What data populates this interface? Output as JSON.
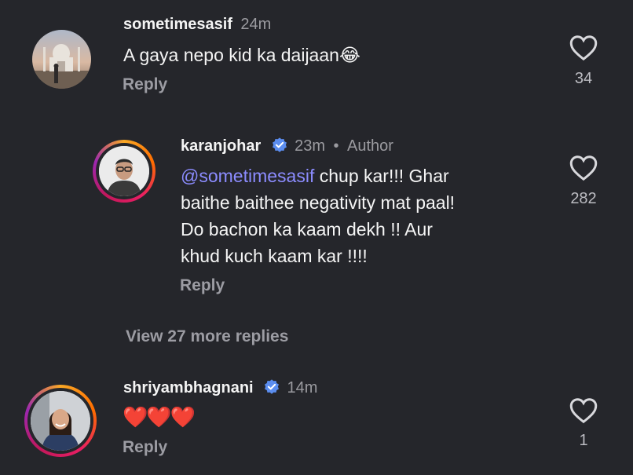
{
  "comments": [
    {
      "username": "sometimesasif",
      "time": "24m",
      "text": "A gaya nepo kid ka daijaan",
      "emoji": "😂",
      "reply_label": "Reply",
      "likes": "34"
    }
  ],
  "reply": {
    "username": "karanjohar",
    "time": "23m",
    "separator": "•",
    "badge": "Author",
    "mention": "@sometimesasif",
    "line1": " chup kar!!! Ghar",
    "line2": "baithe baithee negativity mat paal!",
    "line3": "Do bachon ka kaam dekh !! Aur",
    "line4": "khud kuch kaam kar !!!!",
    "reply_label": "Reply",
    "likes": "282"
  },
  "view_more": "View 27 more replies",
  "comment2": {
    "username": "shriyambhagnani",
    "time": "14m",
    "hearts": "❤️❤️❤️",
    "reply_label": "Reply",
    "likes": "1"
  },
  "colors": {
    "background": "#25262b",
    "verified": "#5b8def",
    "mention": "#8c8cff"
  },
  "icons": {
    "like": "heart-outline-icon",
    "verified": "verified-badge-icon"
  }
}
